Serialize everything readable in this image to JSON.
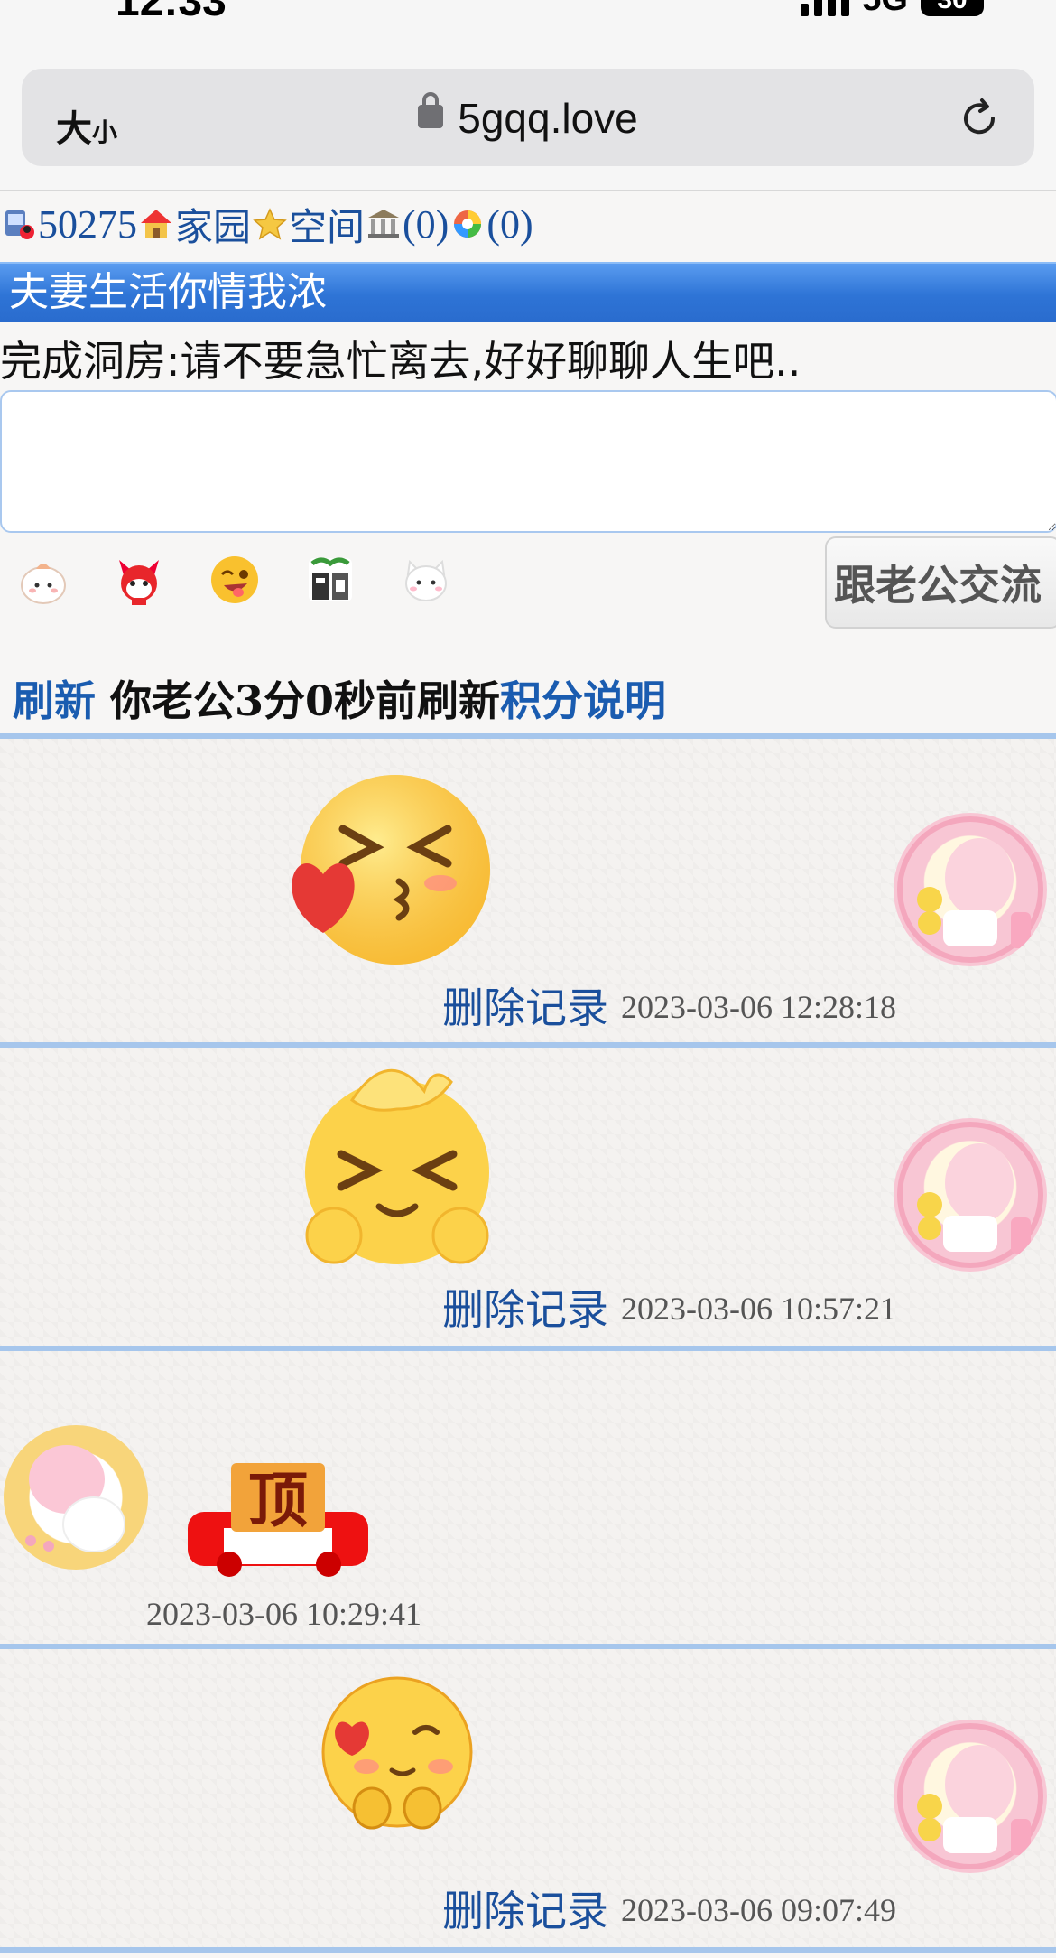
{
  "status_bar": {
    "time": "12:33",
    "network": "5G",
    "battery": "30"
  },
  "browser": {
    "text_size_label": "大",
    "text_size_small": "小",
    "url": "5gqq.love"
  },
  "nav": {
    "user_id": "50275",
    "home_label": "家园",
    "space_label": "空间",
    "bank_count": "(0)",
    "photo_count": "(0)"
  },
  "banner_title": "夫妻生活你情我浓",
  "hint_text": "完成洞房:请不要急忙离去,好好聊聊人生吧..",
  "message_input": {
    "value": "",
    "placeholder": ""
  },
  "send_button_label": "跟老公交流",
  "status_line": {
    "refresh_label": "刷新",
    "partner_status": "你老公3分0秒前刷新",
    "points_label": "积分说明"
  },
  "messages": [
    {
      "side": "right",
      "sticker": "kiss-heart-emoji",
      "delete_label": "删除记录",
      "timestamp": "2023-03-06 12:28:18"
    },
    {
      "side": "right",
      "sticker": "shy-hands-emoji",
      "delete_label": "删除记录",
      "timestamp": "2023-03-06 10:57:21"
    },
    {
      "side": "left",
      "sticker": "top-car-sticker",
      "sticker_text": "顶",
      "timestamp": "2023-03-06 10:29:41"
    },
    {
      "side": "right",
      "sticker": "finger-heart-emoji",
      "delete_label": "删除记录",
      "timestamp": "2023-03-06 09:07:49"
    }
  ],
  "colors": {
    "banner": "#2e74d6",
    "link": "#1a4f9c",
    "divider": "#a6c6ec"
  }
}
